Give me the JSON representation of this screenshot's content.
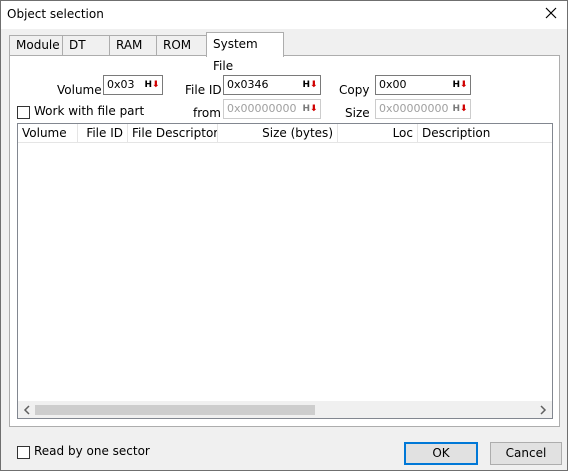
{
  "window": {
    "title": "Object selection"
  },
  "tabs": [
    {
      "label": "Module"
    },
    {
      "label": "DT"
    },
    {
      "label": "RAM"
    },
    {
      "label": "ROM"
    },
    {
      "label": "System File",
      "active": true
    }
  ],
  "form": {
    "volume": {
      "label": "Volume",
      "value": "0x03"
    },
    "file_id": {
      "label": "File ID",
      "value": "0x0346"
    },
    "copy": {
      "label": "Copy",
      "value": "0x00"
    },
    "work_with_file_part": {
      "label": "Work with file part",
      "checked": false
    },
    "from": {
      "label": "from",
      "value": "0x00000000"
    },
    "size": {
      "label": "Size",
      "value": "0x00000000"
    },
    "hex_button_label": "H"
  },
  "table": {
    "columns": [
      "Volume",
      "File ID",
      "File Descriptor",
      "Size (bytes)",
      "Loc",
      "Description"
    ],
    "rows": []
  },
  "footer": {
    "read_by_one_sector": {
      "label": "Read by one sector",
      "checked": false
    },
    "ok_label": "OK",
    "cancel_label": "Cancel"
  }
}
